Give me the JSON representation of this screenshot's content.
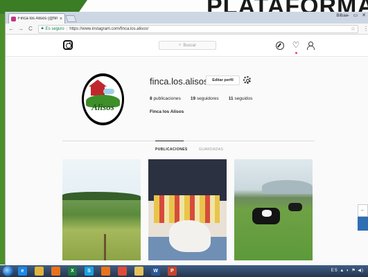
{
  "slide": {
    "title": "PLATAFORMA"
  },
  "browser": {
    "tab_title": "Finca los Alisos (@finca...",
    "tab_close": "×",
    "user_label": "Bilbao",
    "window_controls": "– ▭ ✕",
    "nav": {
      "back": "←",
      "forward": "→",
      "reload": "C"
    },
    "security_label": "Es seguro",
    "url": "https://www.instagram.com/finca.los.alisos/",
    "star": "☆",
    "menu": "⋮"
  },
  "instagram": {
    "search_placeholder": "Buscar",
    "search_icon": "⌕",
    "heart_icon": "♡",
    "profile": {
      "username": "finca.los.alisos",
      "edit_button": "Editar perfil",
      "posts_count": "8",
      "posts_label": "publicaciones",
      "followers_count": "19",
      "followers_label": "seguidores",
      "following_count": "11",
      "following_label": "seguidos",
      "full_name": "Finca los Alisos",
      "avatar_text": "Alisos"
    },
    "tabs": [
      {
        "label": "PUBLICACIONES",
        "active": true
      },
      {
        "label": "GUARDADAS",
        "active": false
      }
    ]
  },
  "side_panel": {
    "arrow": "←"
  },
  "taskbar": {
    "apps": [
      {
        "name": "internet-explorer",
        "glyph": "e",
        "color": "#1e88e5"
      },
      {
        "name": "file-explorer",
        "glyph": "",
        "color": "#e0b43a"
      },
      {
        "name": "firefox",
        "glyph": "",
        "color": "#e8731a"
      },
      {
        "name": "excel",
        "glyph": "X",
        "color": "#1d7a3f"
      },
      {
        "name": "skype",
        "glyph": "S",
        "color": "#1ba1e2"
      },
      {
        "name": "firefox-2",
        "glyph": "",
        "color": "#e8731a"
      },
      {
        "name": "chrome",
        "glyph": "",
        "color": "#dd4b39"
      },
      {
        "name": "folder",
        "glyph": "",
        "color": "#e6c25a"
      },
      {
        "name": "word",
        "glyph": "W",
        "color": "#2b5797"
      },
      {
        "name": "powerpoint",
        "glyph": "P",
        "color": "#c7432a"
      }
    ],
    "tray_text": "ES ▲ ◐ ⚑ ◀)"
  }
}
